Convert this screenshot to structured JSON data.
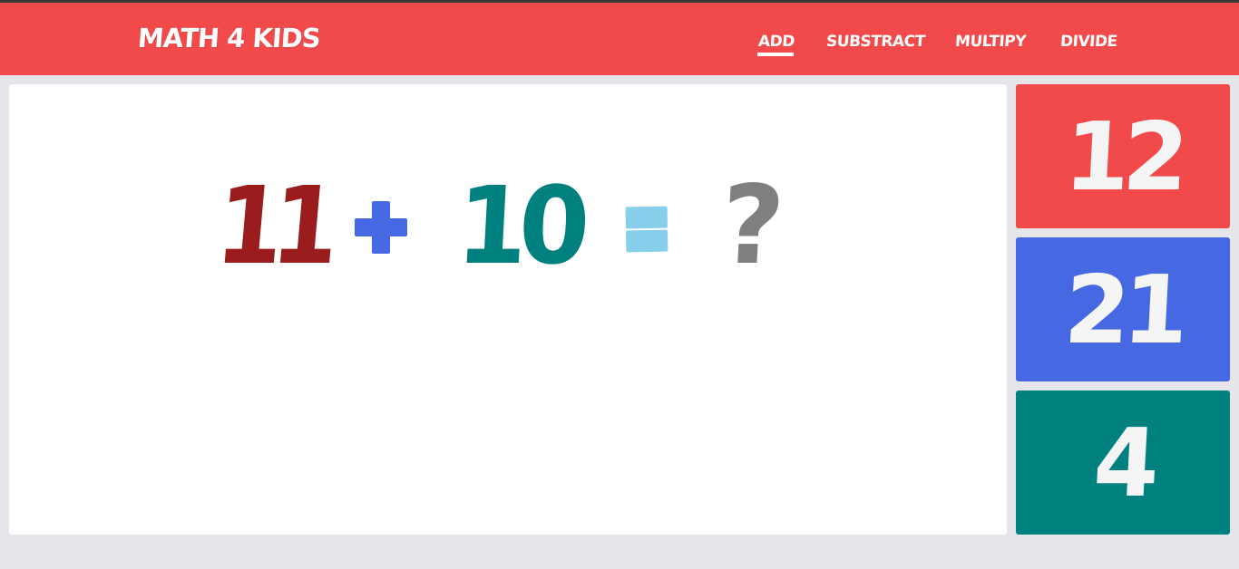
{
  "app": {
    "brand": "MATH 4 KIDS"
  },
  "nav": {
    "items": [
      {
        "label": "ADD",
        "active": true
      },
      {
        "label": "SUBSTRACT",
        "active": false
      },
      {
        "label": "MULTIPY",
        "active": false
      },
      {
        "label": "DIVIDE",
        "active": false
      }
    ]
  },
  "problem": {
    "operand_a": "11",
    "operator": "plus",
    "operand_b": "10",
    "equals": "equals",
    "unknown": "?"
  },
  "answers": [
    {
      "value": "12",
      "color": "#f24a4a"
    },
    {
      "value": "21",
      "color": "#4668e3"
    },
    {
      "value": "4",
      "color": "#00807f"
    }
  ],
  "colors": {
    "header": "#f24a4a",
    "operand_a": "#9b1c1c",
    "operator": "#4668e3",
    "operand_b": "#00807f",
    "equals": "#87ceeb",
    "unknown": "#808080",
    "background": "#e6e6ea"
  }
}
